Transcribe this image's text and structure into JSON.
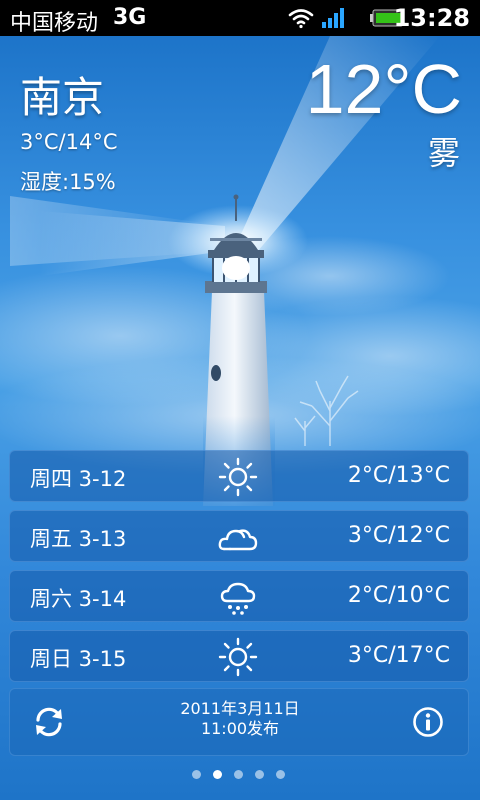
{
  "status_bar": {
    "carrier": "中国移动",
    "network": "3G",
    "time": "13:28",
    "icons": [
      "wifi-icon",
      "signal-icon",
      "battery-icon"
    ]
  },
  "current": {
    "city": "南京",
    "temperature": "12°C",
    "condition": "雾",
    "range": "3°C/14°C",
    "humidity": "湿度:15%"
  },
  "forecast": [
    {
      "day": "周四 3-12",
      "icon": "sunny-icon",
      "temps": "2°C/13°C"
    },
    {
      "day": "周五 3-13",
      "icon": "cloudy-icon",
      "temps": "3°C/12°C"
    },
    {
      "day": "周六 3-14",
      "icon": "rain-icon",
      "temps": "2°C/10°C"
    },
    {
      "day": "周日 3-15",
      "icon": "sunny-icon",
      "temps": "3°C/17°C"
    }
  ],
  "footer": {
    "publish_date": "2011年3月11日",
    "publish_time": "11:00发布",
    "refresh_icon": "refresh-icon",
    "info_icon": "info-icon"
  },
  "pager": {
    "pages": 5,
    "active": 2
  },
  "colors": {
    "background_top": "#1d74c9",
    "background_mid": "#4aa1e6",
    "text": "#ffffff"
  }
}
